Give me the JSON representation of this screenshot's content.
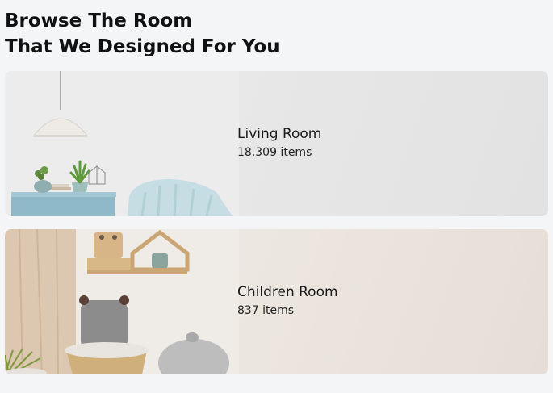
{
  "header": {
    "title_line1": "Browse The Room",
    "title_line2": "That We Designed For You"
  },
  "rooms": [
    {
      "title": "Living Room",
      "count": "18.309 items"
    },
    {
      "title": "Children Room",
      "count": "837 items"
    }
  ]
}
